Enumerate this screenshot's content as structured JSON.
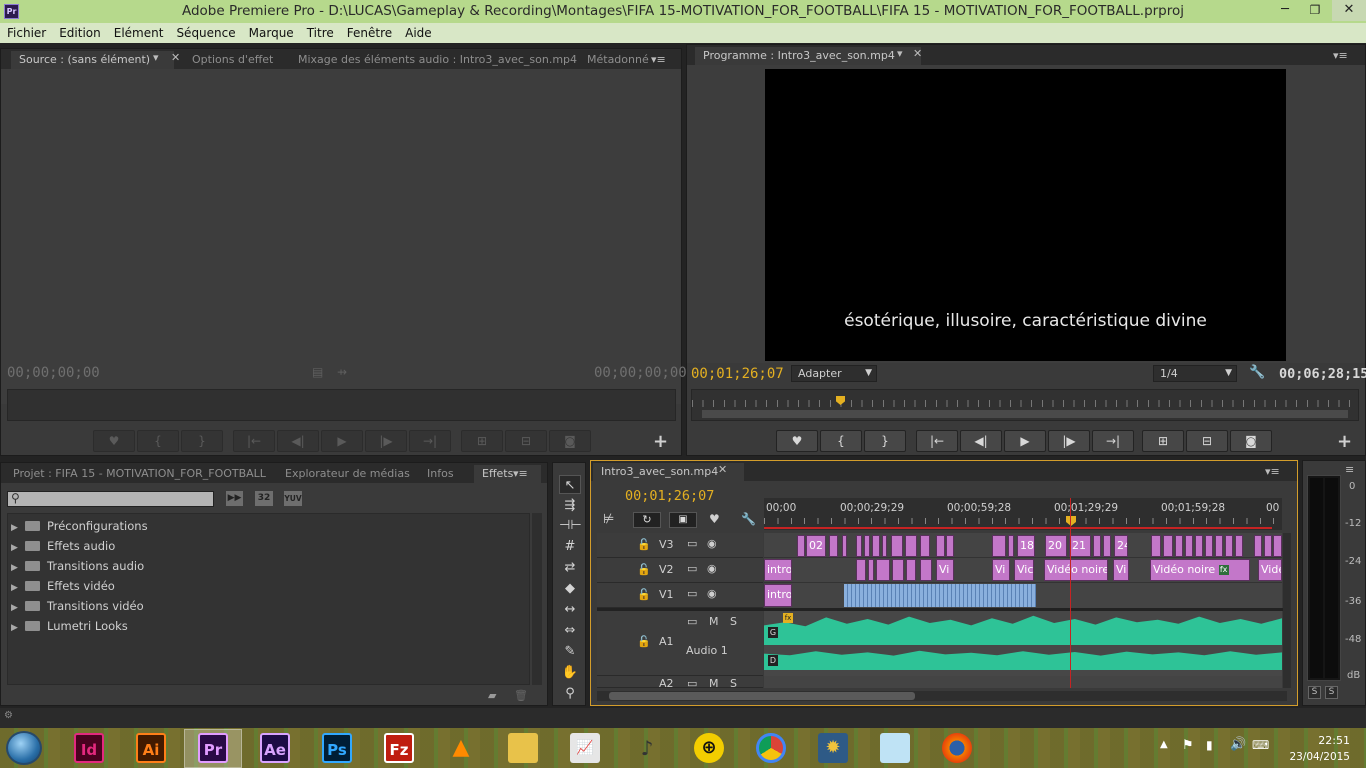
{
  "window": {
    "title": "Adobe Premiere Pro - D:\\LUCAS\\Gameplay & Recording\\Montages\\FIFA 15-MOTIVATION_FOR_FOOTBALL\\FIFA 15 - MOTIVATION_FOR_FOOTBALL.prproj",
    "app_icon": "Pr",
    "min": "─",
    "restore": "❐",
    "close": "✕"
  },
  "menu": [
    "Fichier",
    "Edition",
    "Elément",
    "Séquence",
    "Marque",
    "Titre",
    "Fenêtre",
    "Aide"
  ],
  "source_panel": {
    "tabs": [
      "Source : (sans élément)",
      "Options d'effet",
      "Mixage des éléments audio : Intro3_avec_son.mp4",
      "Métadonné"
    ],
    "tc_left": "00;00;00;00",
    "tc_right": "00;00;00;00"
  },
  "program_panel": {
    "tab": "Programme : Intro3_avec_son.mp4",
    "subtitle": "ésotérique, illusoire, caractéristique divine",
    "timecode": "00;01;26;07",
    "fit": "Adapter",
    "resolution": "1/4",
    "duration": "00;06;28;15"
  },
  "project_panel": {
    "tabs": [
      "Projet : FIFA 15 - MOTIVATION_FOR_FOOTBALL",
      "Explorateur de médias",
      "Infos",
      "Effets"
    ],
    "badges": [
      "32",
      "YUV"
    ],
    "items": [
      "Préconfigurations",
      "Effets audio",
      "Transitions audio",
      "Effets vidéo",
      "Transitions vidéo",
      "Lumetri Looks"
    ]
  },
  "timeline": {
    "tab": "Intro3_avec_son.mp4",
    "timecode": "00;01;26;07",
    "ruler": [
      "00;00",
      "00;00;29;29",
      "00;00;59;28",
      "00;01;29;29",
      "00;01;59;28",
      "00"
    ],
    "tracks": {
      "v3": "V3",
      "v2": "V2",
      "v1": "V1",
      "a1": "A1",
      "a1_name": "Audio 1",
      "a2": "A2",
      "m": "M",
      "s": "S"
    },
    "clip_labels": {
      "c02": "02",
      "c18": "18",
      "c20": "20",
      "c21": "21",
      "c24": "24",
      "intro": "intro",
      "vi": "Vi",
      "vic": "Vic",
      "vid_noire": "Vidéo noire",
      "vid_noire2": "Vidéo noire",
      "vide": "Vidé",
      "intro1": "intro"
    },
    "audio_channels": {
      "left": "G",
      "right": "D"
    }
  },
  "meter": {
    "scale": [
      "0",
      "-12",
      "-24",
      "-36",
      "-48",
      "dB"
    ],
    "solo": "S"
  },
  "taskbar": {
    "apps": [
      {
        "name": "Id",
        "color": "#e3297e",
        "bg": "#49021f"
      },
      {
        "name": "Ai",
        "color": "#ff7f18",
        "bg": "#421a00"
      },
      {
        "name": "Pr",
        "color": "#e19cff",
        "bg": "#2a0a46"
      },
      {
        "name": "Ae",
        "color": "#d8a3ff",
        "bg": "#1c0b46"
      },
      {
        "name": "Ps",
        "color": "#31a8ff",
        "bg": "#001e36"
      },
      {
        "name": "Fz",
        "color": "#ffffff",
        "bg": "#bf1e10"
      }
    ],
    "time": "22:51",
    "date": "23/04/2015"
  }
}
